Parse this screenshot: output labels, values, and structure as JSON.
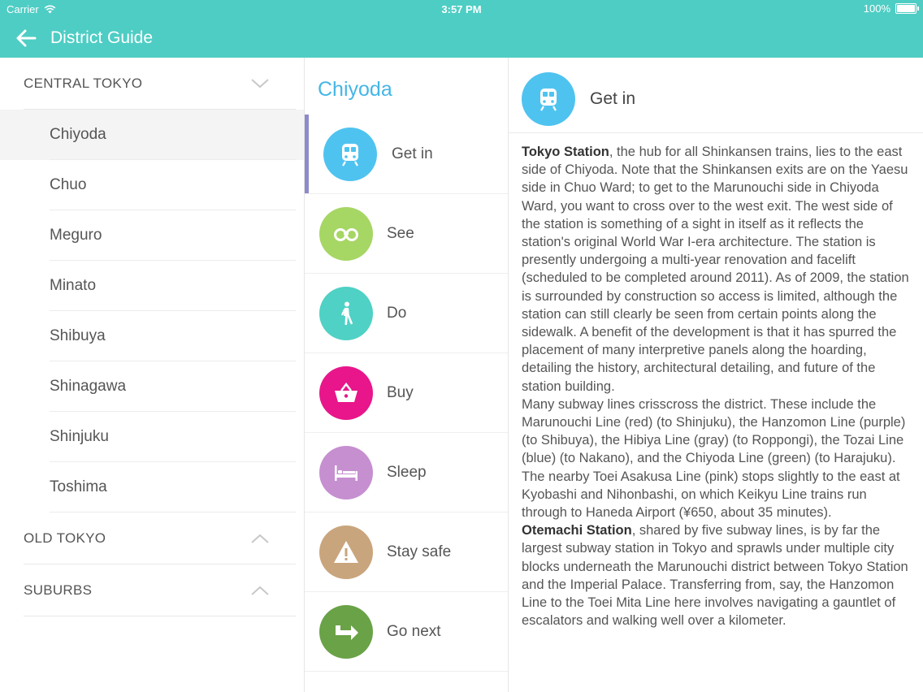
{
  "status": {
    "carrier": "Carrier",
    "time": "3:57 PM",
    "battery": "100%"
  },
  "nav": {
    "title": "District Guide"
  },
  "sidebar": {
    "sections": [
      {
        "label": "CENTRAL TOKYO",
        "expanded": true,
        "items": [
          "Chiyoda",
          "Chuo",
          "Meguro",
          "Minato",
          "Shibuya",
          "Shinagawa",
          "Shinjuku",
          "Toshima"
        ]
      },
      {
        "label": "OLD TOKYO",
        "expanded": false
      },
      {
        "label": "SUBURBS",
        "expanded": false
      }
    ],
    "selected": "Chiyoda"
  },
  "categories": {
    "title": "Chiyoda",
    "items": [
      {
        "label": "Get in",
        "icon": "train-icon",
        "color": "#4fc3f0"
      },
      {
        "label": "See",
        "icon": "binoculars-icon",
        "color": "#a6d664"
      },
      {
        "label": "Do",
        "icon": "walking-person-icon",
        "color": "#4fd1c5"
      },
      {
        "label": "Buy",
        "icon": "shopping-basket-icon",
        "color": "#e8168a"
      },
      {
        "label": "Sleep",
        "icon": "bed-icon",
        "color": "#c68fd0"
      },
      {
        "label": "Stay safe",
        "icon": "warning-icon",
        "color": "#c9a57d"
      },
      {
        "label": "Go next",
        "icon": "turn-arrow-icon",
        "color": "#6aa247"
      }
    ]
  },
  "detail": {
    "title": "Get in",
    "p1_bold": "Tokyo Station",
    "p1_text": ", the hub for all Shinkansen trains, lies to the east side of Chiyoda. Note that the Shinkansen exits are on the Yaesu side in Chuo Ward; to get to the Marunouchi side in Chiyoda Ward, you want to cross over to the west exit. The west side of the station is something of a sight in itself as it reflects the station's original World War I-era architecture. The station is presently undergoing a multi-year renovation and facelift (scheduled to be completed around 2011). As of 2009, the station is surrounded by construction so access is limited, although the station can still clearly be seen from certain points along the sidewalk. A benefit of the development is that it has spurred the placement of many interpretive panels along the hoarding, detailing the history, architectural detailing, and future of the station building.",
    "p2_text": "Many subway lines crisscross the district. These include the Marunouchi Line (red) (to Shinjuku), the Hanzomon Line (purple) (to Shibuya), the Hibiya Line (gray) (to Roppongi), the Tozai Line (blue) (to Nakano), and the Chiyoda Line (green) (to Harajuku). The nearby Toei Asakusa Line (pink) stops slightly to the east at Kyobashi and Nihonbashi, on which Keikyu Line trains run through to Haneda Airport (¥650, about 35 minutes).",
    "p3_bold": "Otemachi Station",
    "p3_text": ", shared by five subway lines, is by far the largest subway station in Tokyo and sprawls under multiple city blocks underneath the Marunouchi district between Tokyo Station and the Imperial Palace. Transferring from, say, the Hanzomon Line to the Toei Mita Line here involves navigating a gauntlet of escalators and walking well over a kilometer."
  },
  "colors": {
    "header": "#4ecdc4",
    "title_accent": "#45b6e6",
    "active_bar": "#8d8bc9"
  }
}
